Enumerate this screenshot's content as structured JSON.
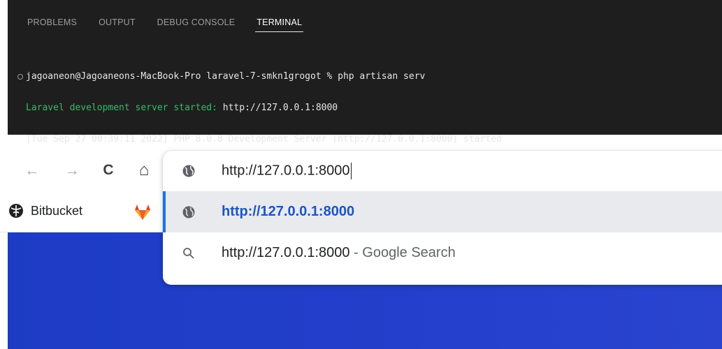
{
  "terminal": {
    "tabs": [
      {
        "label": "PROBLEMS",
        "active": false
      },
      {
        "label": "OUTPUT",
        "active": false
      },
      {
        "label": "DEBUG CONSOLE",
        "active": false
      },
      {
        "label": "TERMINAL",
        "active": true
      }
    ],
    "lines": {
      "prompt": "jagoaneon@Jagoaneons-MacBook-Pro laravel-7-smkn1grogot % php artisan serv",
      "started_label": "Laravel development server started:",
      "started_url": " http://127.0.0.1:8000",
      "log": "[Tue Sep 27 00:39:11 2022] PHP 8.0.8 Development Server (http://127.0.0.1:8000) started"
    },
    "colors": {
      "background": "#1e1e1e",
      "success": "#2bc26a"
    }
  },
  "browser": {
    "nav_icons": [
      "back-arrow-icon",
      "forward-arrow-icon",
      "reload-icon",
      "home-icon"
    ],
    "nav_glyphs": {
      "back": "←",
      "forward": "→",
      "reload": "C",
      "home": "⌂"
    },
    "omnibox": {
      "input_value": "http://127.0.0.1:8000",
      "suggestions": [
        {
          "text": "http://127.0.0.1:8000",
          "suffix": "",
          "icon": "globe-icon",
          "selected": true
        },
        {
          "text": "http://127.0.0.1:8000",
          "suffix": " - Google Search",
          "icon": "search-icon",
          "selected": false
        }
      ]
    },
    "bookmarks": [
      {
        "label": "Bitbucket",
        "icon": "bitbucket-icon"
      },
      {
        "label": "",
        "icon": "gitlab-icon"
      }
    ],
    "colors": {
      "page_background": "#233fcb",
      "accent": "#1a73e8",
      "link": "#1a56c7"
    }
  }
}
